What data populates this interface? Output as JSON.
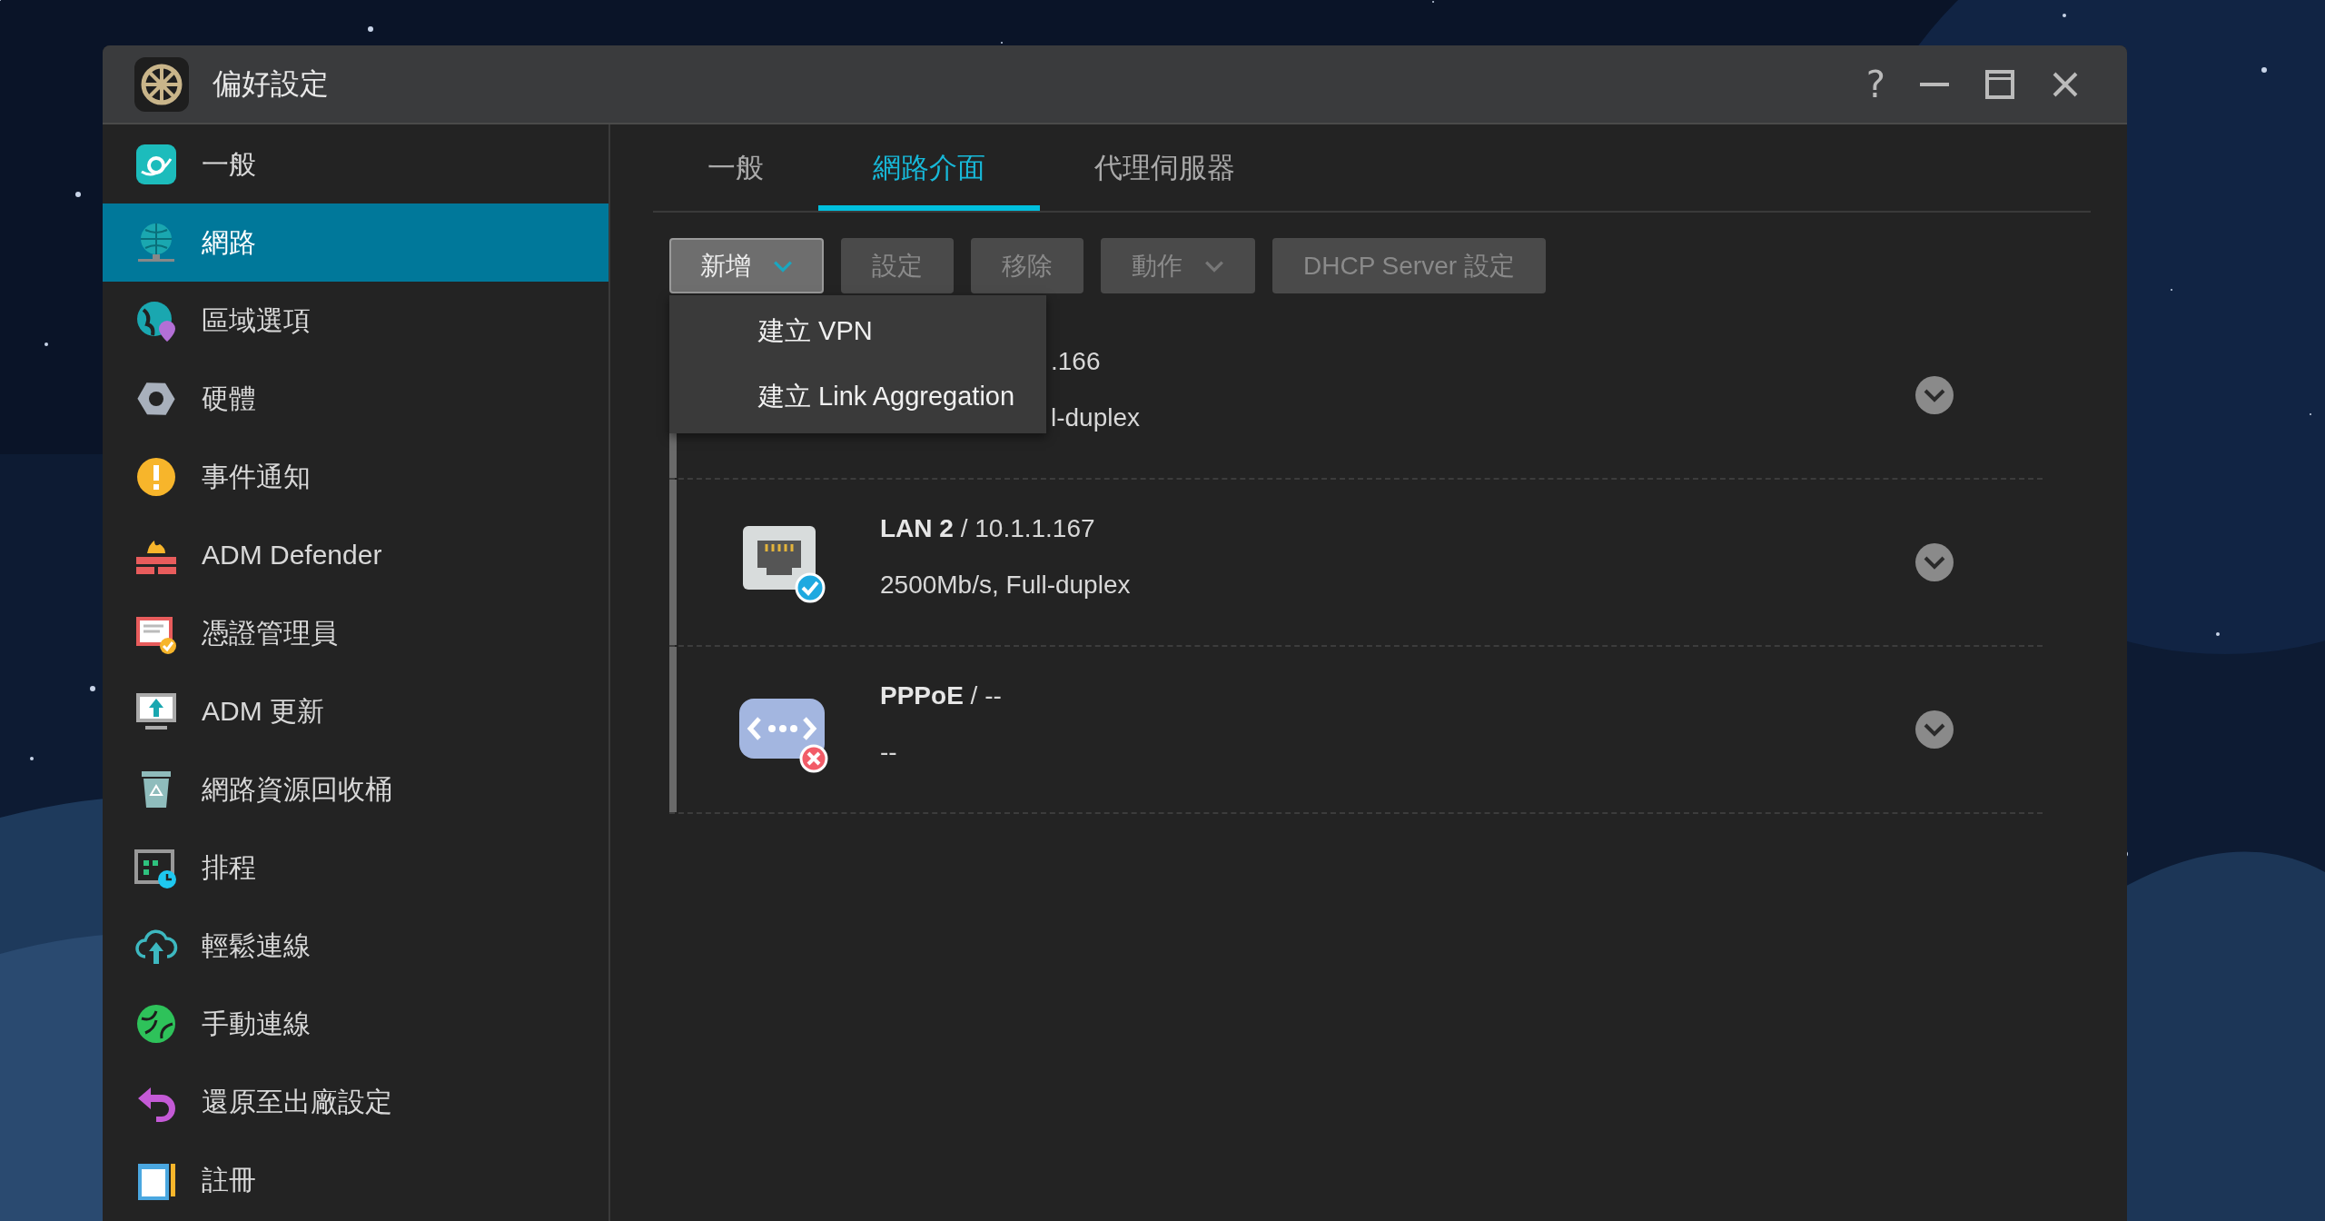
{
  "window": {
    "title": "偏好設定",
    "help": "?"
  },
  "sidebar": {
    "items": [
      {
        "label": "一般",
        "selected": false
      },
      {
        "label": "網路",
        "selected": true
      },
      {
        "label": "區域選項",
        "selected": false
      },
      {
        "label": "硬體",
        "selected": false
      },
      {
        "label": "事件通知",
        "selected": false
      },
      {
        "label": "ADM Defender",
        "selected": false
      },
      {
        "label": "憑證管理員",
        "selected": false
      },
      {
        "label": "ADM 更新",
        "selected": false
      },
      {
        "label": "網路資源回收桶",
        "selected": false
      },
      {
        "label": "排程",
        "selected": false
      },
      {
        "label": "輕鬆連線",
        "selected": false
      },
      {
        "label": "手動連線",
        "selected": false
      },
      {
        "label": "還原至出廠設定",
        "selected": false
      },
      {
        "label": "註冊",
        "selected": false
      }
    ]
  },
  "tabs": [
    {
      "label": "一般",
      "selected": false
    },
    {
      "label": "網路介面",
      "selected": true
    },
    {
      "label": "代理伺服器",
      "selected": false
    }
  ],
  "toolbar": [
    {
      "label": "新增",
      "disabled": false,
      "dropdown": true,
      "open": true,
      "menu": [
        "建立 VPN",
        "建立 Link Aggregation"
      ]
    },
    {
      "label": "設定",
      "disabled": true,
      "dropdown": false,
      "open": false
    },
    {
      "label": "移除",
      "disabled": true,
      "dropdown": false,
      "open": false
    },
    {
      "label": "動作",
      "disabled": true,
      "dropdown": true,
      "open": false
    },
    {
      "label": "DHCP Server 設定",
      "disabled": true,
      "dropdown": false,
      "open": false
    }
  ],
  "interfaces": [
    {
      "kind": "covered",
      "title": ".166",
      "detail": "l-duplex"
    },
    {
      "kind": "ethernet",
      "connected": true,
      "title": "**LAN 2** / 10.1.1.167",
      "detail": "2500Mb/s, Full-duplex"
    },
    {
      "kind": "pppoe",
      "connected": false,
      "title": "**PPPoE** / --",
      "detail": "--"
    }
  ]
}
